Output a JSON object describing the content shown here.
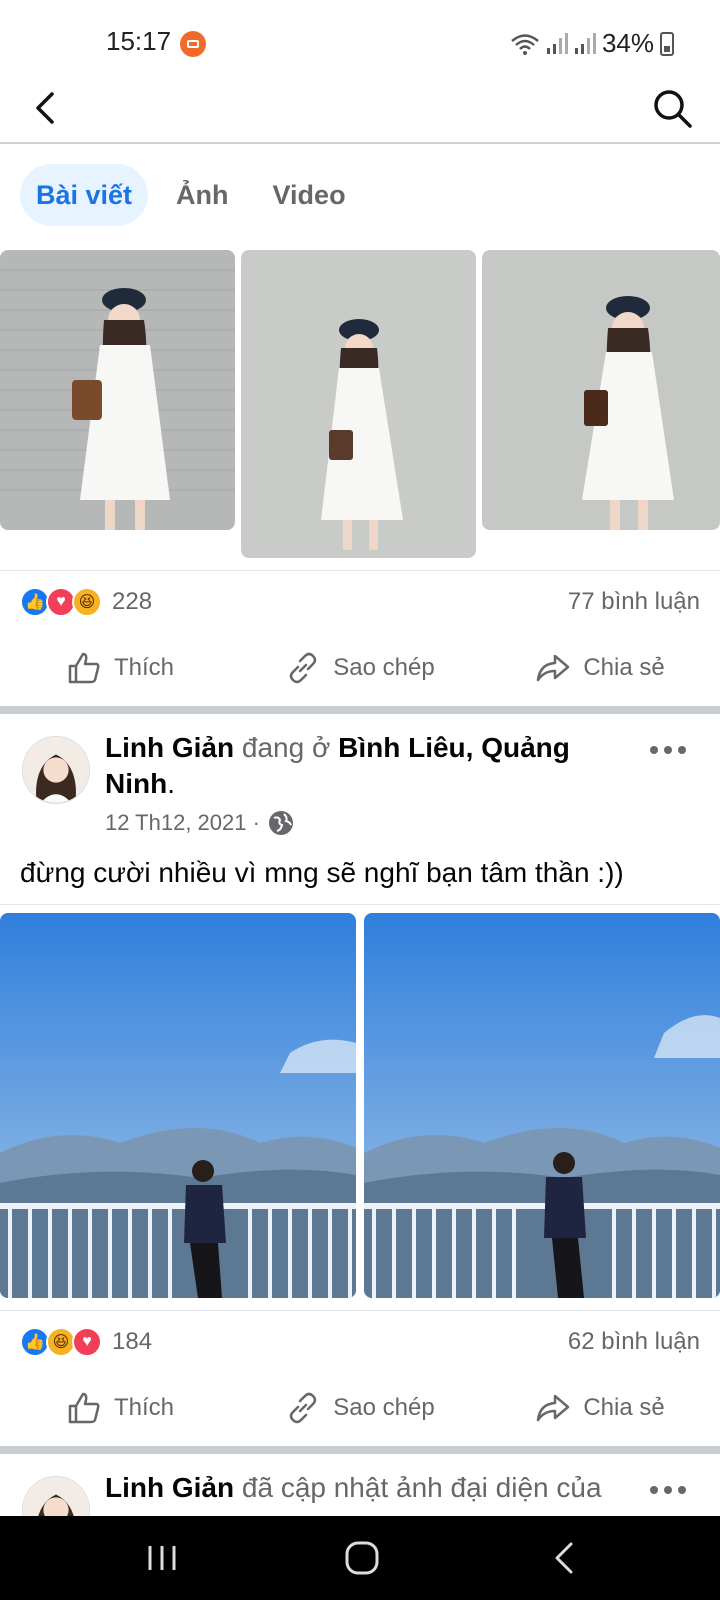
{
  "status": {
    "time": "15:17",
    "battery": "34%"
  },
  "tabs": [
    {
      "label": "Bài viết",
      "active": true
    },
    {
      "label": "Ảnh",
      "active": false
    },
    {
      "label": "Video",
      "active": false
    }
  ],
  "post1": {
    "reaction_count": "228",
    "comment_count": "77 bình luận"
  },
  "post2": {
    "author": "Linh Giản",
    "verb": "đang ở",
    "location": "Bình Liêu, Quảng Ninh",
    "date": "12 Th12, 2021 ·",
    "text": "đừng cười nhiều vì mng sẽ nghĩ bạn tâm thần :))",
    "reaction_count": "184",
    "comment_count": "62 bình luận"
  },
  "post3": {
    "author": "Linh Giản",
    "verb": "đã cập nhật ảnh đại diện của"
  },
  "actions": {
    "like": "Thích",
    "copy": "Sao chép",
    "share": "Chia sẻ"
  },
  "colors": {
    "accent": "#1b74e4",
    "like": "#1877f2",
    "love": "#f33e58",
    "haha": "#f7b125"
  },
  "icons": [
    "back-icon",
    "search-icon",
    "like-icon",
    "link-icon",
    "share-icon",
    "globe-icon",
    "more-icon"
  ]
}
